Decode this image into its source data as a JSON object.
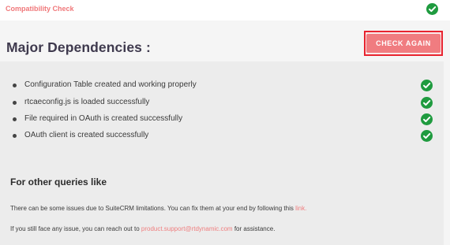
{
  "topbar": {
    "title": "Compatibility Check",
    "status_icon": "check-circle-icon",
    "accent": "#f0787a"
  },
  "header": {
    "title": "Major Dependencies :",
    "check_again_label": "CHECK AGAIN"
  },
  "dependencies": [
    {
      "label": "Configuration Table created and working properly",
      "status": "ok"
    },
    {
      "label": "rtcaeconfig.js is loaded successfully",
      "status": "ok"
    },
    {
      "label": "File required in OAuth is created successfully",
      "status": "ok"
    },
    {
      "label": "OAuth client is created successfully",
      "status": "ok"
    }
  ],
  "queries": {
    "title": "For other queries like",
    "line1_prefix": "There can be some issues due to SuiteCRM limitations. You can fix them at your end by following this ",
    "line1_link": "link.",
    "line2_prefix": "If you still face any issue, you can reach out to ",
    "line2_link": "product.support@rtdynamic.com",
    "line2_suffix": " for assistance."
  },
  "colors": {
    "success_green": "#1f9b3f",
    "button_bg": "#f07c80",
    "highlight_border": "#e8232f",
    "link": "#ef7e7f"
  }
}
